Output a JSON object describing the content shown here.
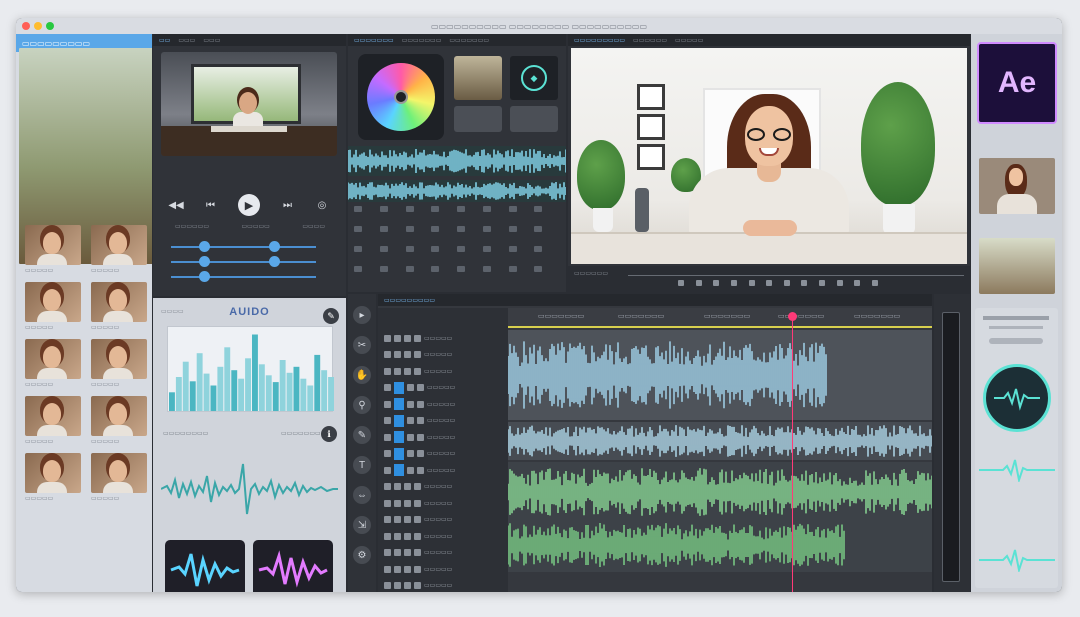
{
  "window": {
    "title": "▭▭▭▭▭▭▭▭▭▭ ▭▭▭▭▭▭▭▭ ▭▭▭▭▭▭▭▭▭▭"
  },
  "sidebar": {
    "header": "▭▭▭▭▭▭▭▭▭",
    "thumbnails": [
      {
        "kind": "person",
        "caption": "▭▭▭▭▭"
      },
      {
        "kind": "person",
        "caption": "▭▭▭▭▭"
      },
      {
        "kind": "list",
        "caption": "▭▭▭▭▭"
      },
      {
        "kind": "scene",
        "caption": "▭▭▭▭▭"
      },
      {
        "kind": "scene",
        "caption": "▭▭▭▭▭"
      },
      {
        "kind": "scene",
        "caption": "▭▭▭▭▭"
      },
      {
        "kind": "scene",
        "caption": "▭▭▭▭▭"
      },
      {
        "kind": "scene",
        "caption": "▭▭▭▭▭"
      },
      {
        "kind": "scene",
        "caption": "▭▭▭▭▭"
      },
      {
        "kind": "scene",
        "caption": "▭▭▭▭▭"
      },
      {
        "kind": "person",
        "caption": "▭▭▭▭▭"
      },
      {
        "kind": "person",
        "caption": "▭▭▭▭▭"
      },
      {
        "kind": "person",
        "caption": "▭▭▭▭▭"
      },
      {
        "kind": "person",
        "caption": "▭▭▭▭▭"
      },
      {
        "kind": "person",
        "caption": "▭▭▭▭▭"
      },
      {
        "kind": "person",
        "caption": "▭▭▭▭▭"
      },
      {
        "kind": "person",
        "caption": "▭▭▭▭▭"
      },
      {
        "kind": "person",
        "caption": "▭▭▭▭▭"
      },
      {
        "kind": "person",
        "caption": "▭▭▭▭▭"
      },
      {
        "kind": "person",
        "caption": "▭▭▭▭▭"
      }
    ]
  },
  "preview_small": {
    "tabs": [
      "▭▭",
      "▭▭▭",
      "▭▭▭"
    ],
    "labels": [
      "▭▭▭▭▭▭",
      "▭▭▭▭▭",
      "▭▭▭▭"
    ]
  },
  "analyzer": {
    "title": "AUIDO",
    "subtitle_left": "▭▭▭▭",
    "section_label": "▭▭▭▭▭▭▭▭",
    "section_label_right": "▭▭▭▭▭▭▭",
    "spectrum_bars": [
      22,
      40,
      58,
      35,
      68,
      44,
      30,
      52,
      75,
      48,
      38,
      62,
      90,
      55,
      42,
      34,
      60,
      45,
      52,
      38,
      30,
      66,
      48,
      40
    ]
  },
  "tools": {
    "tabs": [
      "▭▭▭▭▭▭▭",
      "▭▭▭▭▭▭▭",
      "▭▭▭▭▭▭▭"
    ]
  },
  "viewer": {
    "tabs": [
      "▭▭▭▭▭▭▭▭▭",
      "▭▭▭▭▭▭",
      "▭▭▭▭▭"
    ],
    "bar_label": "▭▭▭▭▭▭"
  },
  "aecol": {
    "logo_text": "Ae"
  },
  "timeline": {
    "header_label": "▭▭▭▭▭▭▭▭▭",
    "ruler_marks": [
      "▭▭▭▭▭▭▭",
      "▭▭▭▭▭▭▭",
      "▭▭▭▭▭▭▭",
      "▭▭▭▭▭▭▭",
      "▭▭▭▭▭▭▭"
    ],
    "tracks": [
      "▭▭▭▭▭",
      "▭▭▭▭▭",
      "▭▭▭▭▭",
      "▭▭▭▭▭",
      "▭▭▭▭▭",
      "▭▭▭▭▭",
      "▭▭▭▭▭",
      "▭▭▭▭▭",
      "▭▭▭▭▭",
      "▭▭▭▭▭",
      "▭▭▭▭▭",
      "▭▭▭▭▭",
      "▭▭▭▭▭",
      "▭▭▭▭▭",
      "▭▭▭▭▭",
      "▭▭▭▭▭"
    ]
  },
  "colors": {
    "accent_blue": "#5aa7e8",
    "waveform_cyan": "#8ee6ff",
    "waveform_green": "#7fd88a",
    "playhead": "#ff3a78",
    "ae_purple": "#d08bff"
  }
}
